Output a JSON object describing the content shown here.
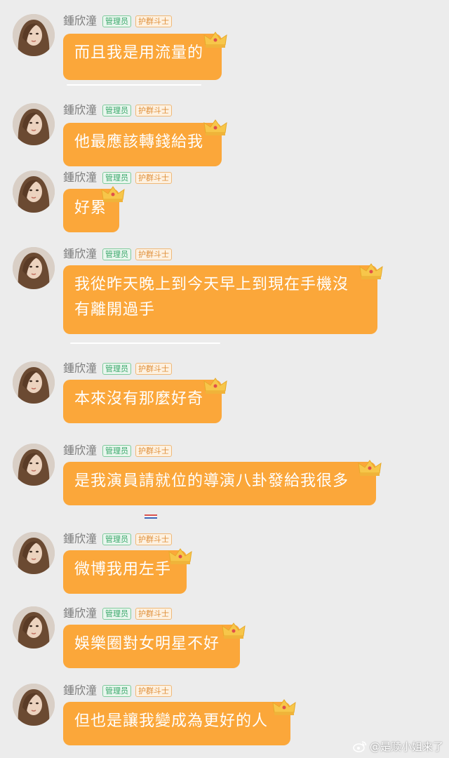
{
  "chat": {
    "messages": [
      {
        "sender": "鍾欣潼",
        "badges": {
          "admin": "管理员",
          "guard": "护群斗士"
        },
        "text": "而且我是用流量的"
      },
      {
        "sender": "鍾欣潼",
        "badges": {
          "admin": "管理员",
          "guard": "护群斗士"
        },
        "text": "他最應該轉錢給我"
      },
      {
        "sender": "鍾欣潼",
        "badges": {
          "admin": "管理员",
          "guard": "护群斗士"
        },
        "text": "好累"
      },
      {
        "sender": "鍾欣潼",
        "badges": {
          "admin": "管理员",
          "guard": "护群斗士"
        },
        "text": "我從昨天晚上到今天早上到現在手機沒\n有離開過手"
      },
      {
        "sender": "鍾欣潼",
        "badges": {
          "admin": "管理员",
          "guard": "护群斗士"
        },
        "text": "本來沒有那麼好奇"
      },
      {
        "sender": "鍾欣潼",
        "badges": {
          "admin": "管理员",
          "guard": "护群斗士"
        },
        "text": "是我演員請就位的導演八卦發給我很多"
      },
      {
        "sender": "鍾欣潼",
        "badges": {
          "admin": "管理员",
          "guard": "护群斗士"
        },
        "text": "微博我用左手"
      },
      {
        "sender": "鍾欣潼",
        "badges": {
          "admin": "管理员",
          "guard": "护群斗士"
        },
        "text": "娛樂圈對女明星不好"
      },
      {
        "sender": "鍾欣潼",
        "badges": {
          "admin": "管理员",
          "guard": "护群斗士"
        },
        "text": "但也是讓我變成為更好的人"
      }
    ]
  },
  "watermark": {
    "text": "@是赎小姐来了",
    "icon": "weibo-icon"
  },
  "colors": {
    "bubble": "#fba73a",
    "background": "#ececec",
    "admin_badge": "#3aa86b",
    "guard_badge": "#e0903a"
  }
}
